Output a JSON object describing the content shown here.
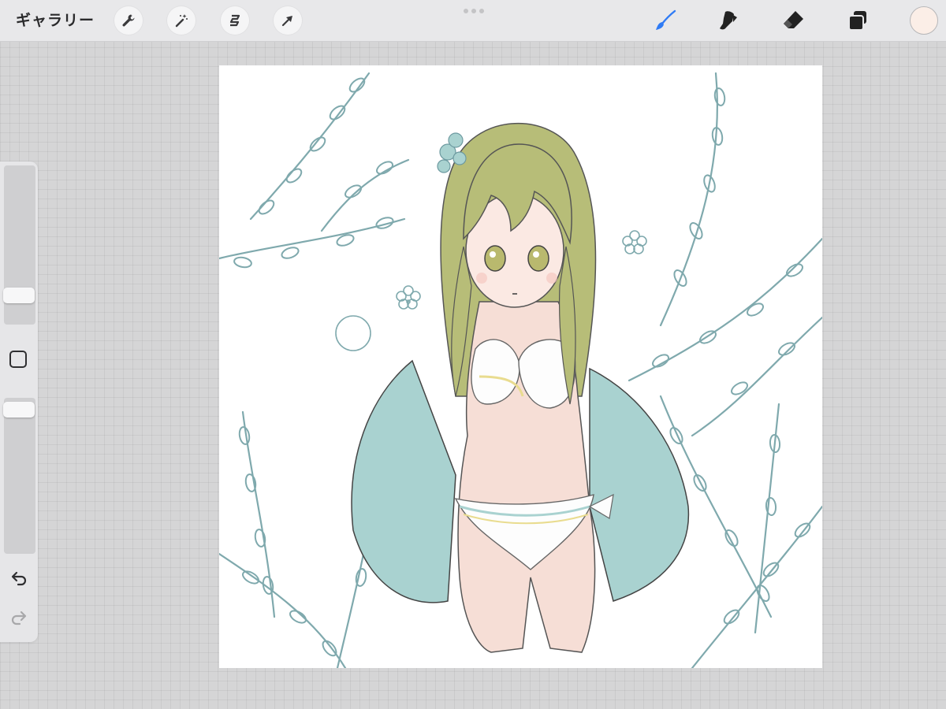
{
  "toolbar": {
    "gallery_label": "ギャラリー",
    "left_tools": [
      "wrench-icon",
      "magic-wand-icon",
      "selection-icon",
      "transform-arrow-icon"
    ],
    "right_tools": [
      "brush-icon",
      "smudge-icon",
      "eraser-icon",
      "layers-icon"
    ],
    "active_tool": "brush",
    "active_color": "#fbeee7",
    "accent_color": "#2f7bf5"
  },
  "sidebar": {
    "brush_size_level": 0.15,
    "opacity_level": 0.97,
    "buttons": [
      "modify-button",
      "undo-icon",
      "redo-icon"
    ],
    "redo_enabled": false
  },
  "canvas": {
    "content": "illustration",
    "palette": {
      "hair": "#b7bd78",
      "jacket": "#a9d2d0",
      "skin": "#f6ded6",
      "plants": "#7fa9ad"
    }
  }
}
